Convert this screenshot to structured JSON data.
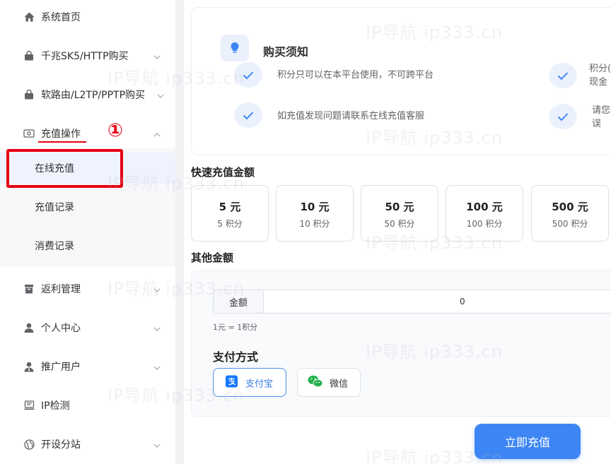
{
  "sidebar": {
    "items": [
      {
        "label": "系统首页",
        "icon": "home-icon"
      },
      {
        "label": "千兆SK5/HTTP购买",
        "icon": "bag-icon"
      },
      {
        "label": "软路由/L2TP/PPTP购买",
        "icon": "bag-icon"
      },
      {
        "label": "充值操作",
        "icon": "wallet-icon"
      },
      {
        "label": "返利管理",
        "icon": "gift-icon"
      },
      {
        "label": "个人中心",
        "icon": "user-icon"
      },
      {
        "label": "推广用户",
        "icon": "user-plus-icon"
      },
      {
        "label": "IP检测",
        "icon": "monitor-icon"
      },
      {
        "label": "开设分站",
        "icon": "globe-icon"
      }
    ],
    "submenu": [
      {
        "label": "在线充值",
        "active": true
      },
      {
        "label": "充值记录"
      },
      {
        "label": "消费记录"
      }
    ]
  },
  "annotation": {
    "marker": "①",
    "color": "#e60012"
  },
  "notice": {
    "title": "购买须知",
    "items": [
      {
        "lines": [
          "积分只可以在本平台使用，不可跨平台"
        ]
      },
      {
        "lines": [
          "积分(",
          "现金"
        ]
      },
      {
        "lines": [
          "如充值发现问题请联系在线充值客服"
        ]
      },
      {
        "lines": [
          "请您",
          "误"
        ]
      }
    ]
  },
  "quick": {
    "title": "快速充值金额",
    "options": [
      {
        "value": "5 元",
        "points": "5 积分"
      },
      {
        "value": "10 元",
        "points": "10 积分"
      },
      {
        "value": "50 元",
        "points": "50 积分"
      },
      {
        "value": "100 元",
        "points": "100 积分"
      },
      {
        "value": "500 元",
        "points": "500 积分"
      }
    ]
  },
  "other": {
    "title": "其他金额",
    "amount_label": "金额",
    "amount_value": "0",
    "rate": "1元 = 1积分"
  },
  "payment": {
    "title": "支付方式",
    "methods": [
      {
        "label": "支付宝",
        "icon": "alipay-icon",
        "selected": true
      },
      {
        "label": "微信",
        "icon": "wechat-icon",
        "selected": false
      }
    ]
  },
  "submit_label": "立即充值",
  "watermark": {
    "texts": [
      "IP导航 ip333.cn",
      "IP导航 ip333.cn",
      "IP导航 ip333.cn",
      "IP导航 ip333.cn",
      "IP导航 ip333.cn",
      "IP导航 ip333.cn",
      "IP导航 ip333.cn",
      "IP导航 ip333.cn",
      "IP导航 ip333.cn",
      "IP导航 ip333.cn",
      "IP导航 ip333.cn",
      "IP导航 ip333.cn"
    ]
  },
  "colors": {
    "accent": "#3e86f5",
    "annotation": "#e60012",
    "alipay": "#1677ff",
    "wechat": "#22b14c"
  }
}
